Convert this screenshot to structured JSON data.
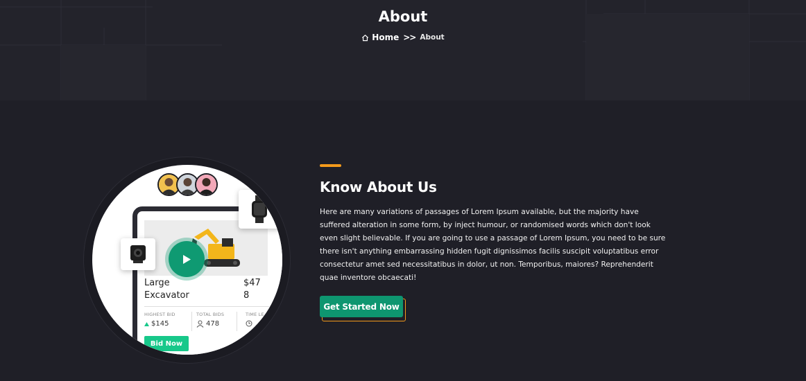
{
  "header": {
    "title": "About",
    "breadcrumb": {
      "home_label": "Home",
      "separator": ">>",
      "current": "About"
    }
  },
  "product_card": {
    "title_left": [
      "Large",
      "Excavator"
    ],
    "title_right": [
      "$47",
      "8"
    ],
    "stats": [
      {
        "label": "HIGHEST BID",
        "value": "$145",
        "icon": "arrow-up-icon"
      },
      {
        "label": "TOTAL BIDS",
        "value": "478",
        "icon": "user-icon"
      },
      {
        "label": "TIME LE",
        "value": "",
        "icon": "clock-icon"
      }
    ],
    "bid_button": "Bid Now"
  },
  "about": {
    "title": "Know About Us",
    "paragraph": "Here are many variations of passages of Lorem Ipsum available, but the majority have suffered alteration in some form, by inject humour, or randomised words which don't look even slight believable. If you are going to use a passage of Lorem Ipsum, you need to be sure there isn't anything embarrassing hidden fugit dignissimos facilis suscipit voluptatibus error consectetur amet sed necessitatibus in dolor, ut non. Temporibus, maiores? Reprehenderit quae inventore obcaecati!",
    "cta": "Get Started Now"
  },
  "colors": {
    "accent": "#f39a1b",
    "primary": "#0e9670",
    "bid": "#17c88a",
    "background": "#1f1f27"
  }
}
